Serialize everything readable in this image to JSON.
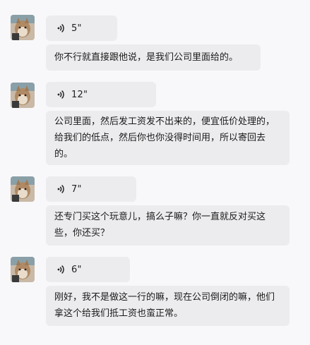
{
  "messages": [
    {
      "duration": "5\"",
      "transcript": "你不行就直接跟他说，是我们公司里面给的。"
    },
    {
      "duration": "12\"",
      "transcript": "公司里面，然后发工资发不出来的，便宜低价处理的，给我们的低点，然后你也你没得时间用，所以寄回去的。"
    },
    {
      "duration": "7\"",
      "transcript": "还专门买这个玩意儿，搞么子嘛？你一直就反对买这些，你还买？"
    },
    {
      "duration": "6\"",
      "transcript": "刚好，我不是做这一行的嘛，现在公司倒闭的嘛，他们拿这个给我们抵工资也蛮正常。"
    }
  ],
  "icons": {
    "avatar": "cat-photo-avatar",
    "voice": "voice-wave-icon"
  },
  "colors": {
    "background": "#f8f8fa",
    "bubble": "#ececef",
    "text": "#1a1a1a"
  }
}
